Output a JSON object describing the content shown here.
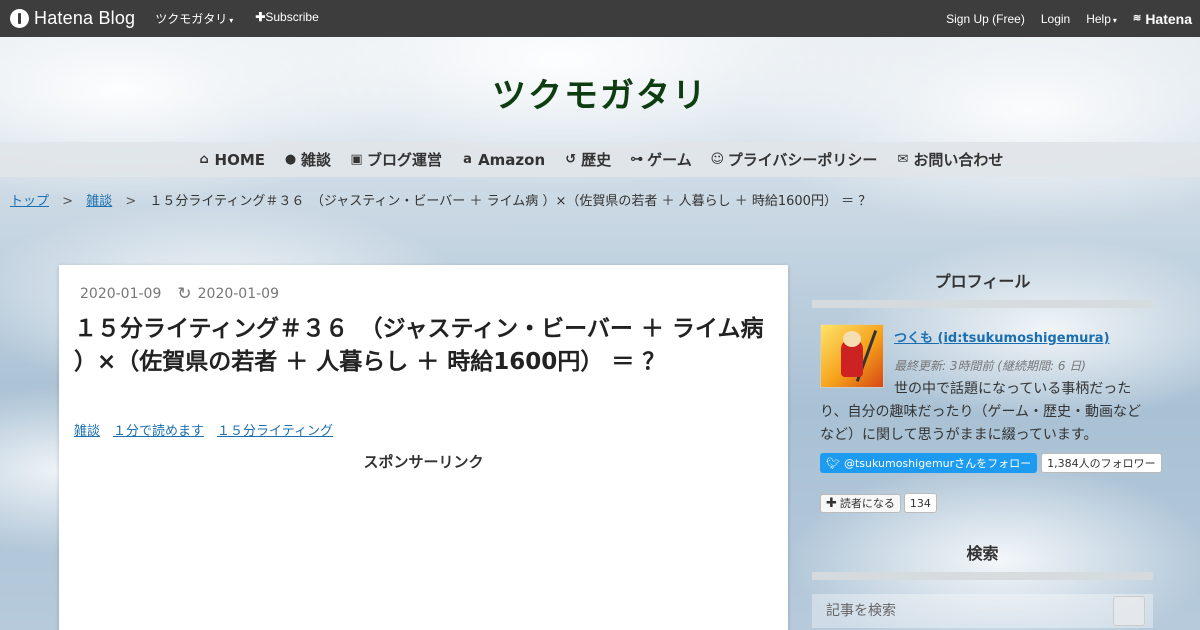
{
  "topbar": {
    "brand": "Hatena Blog",
    "blog_menu": "ツクモガタリ",
    "subscribe": "Subscribe",
    "signup": "Sign Up (Free)",
    "login": "Login",
    "help": "Help",
    "hatena": "Hatena"
  },
  "blog": {
    "title": "ツクモガタリ"
  },
  "nav": {
    "items": [
      {
        "icon": "home-icon",
        "label": "HOME"
      },
      {
        "icon": "chat-icon",
        "label": "雑談"
      },
      {
        "icon": "blogger-icon",
        "label": "ブログ運営"
      },
      {
        "icon": "amazon-icon",
        "label": "Amazon"
      },
      {
        "icon": "history-icon",
        "label": "歴史"
      },
      {
        "icon": "gamepad-icon",
        "label": "ゲーム"
      },
      {
        "icon": "smile-icon",
        "label": "プライバシーポリシー"
      },
      {
        "icon": "mail-icon",
        "label": "お問い合わせ"
      }
    ]
  },
  "breadcrumb": {
    "top": "トップ",
    "category": "雑談",
    "current": "１５分ライティング＃３６　（ジャスティン・ビーバー ＋ ライム病 ）×（佐賀県の若者 ＋ 人暮らし ＋ 時給1600円） ＝ ？",
    "separator": ">"
  },
  "article": {
    "date": "2020-01-09",
    "updated": "2020-01-09",
    "title": "１５分ライティング＃３６　（ジャスティン・ビーバー ＋ ライム病 ）×（佐賀県の若者 ＋ 人暮らし ＋ 時給1600円） ＝ ？",
    "categories": [
      "雑談",
      "１分で読めます",
      "１５分ライティング"
    ],
    "sponsor": "スポンサーリンク"
  },
  "profile": {
    "heading": "プロフィール",
    "name": "つくも (id:tsukumoshigemura)",
    "last_update": "最終更新: 3時間前 (継続期間: 6 日)",
    "desc_line1": "世の中で話題になっている事柄だった",
    "desc_rest": "り、自分の趣味だったり（ゲーム・歴史・動画などなど）に関して思うがままに綴っています。",
    "twitter_follow": "@tsukumoshigemurさんをフォロー",
    "follower_count": "1,384人のフォロワー",
    "reader_button": "読者になる",
    "reader_count": "134"
  },
  "search": {
    "heading": "検索",
    "placeholder": "記事を検索"
  },
  "colors": {
    "topbar": "#3d3d3d",
    "title": "#0f3d12",
    "link": "#1a6fb1",
    "twitter": "#1d9bf0"
  }
}
